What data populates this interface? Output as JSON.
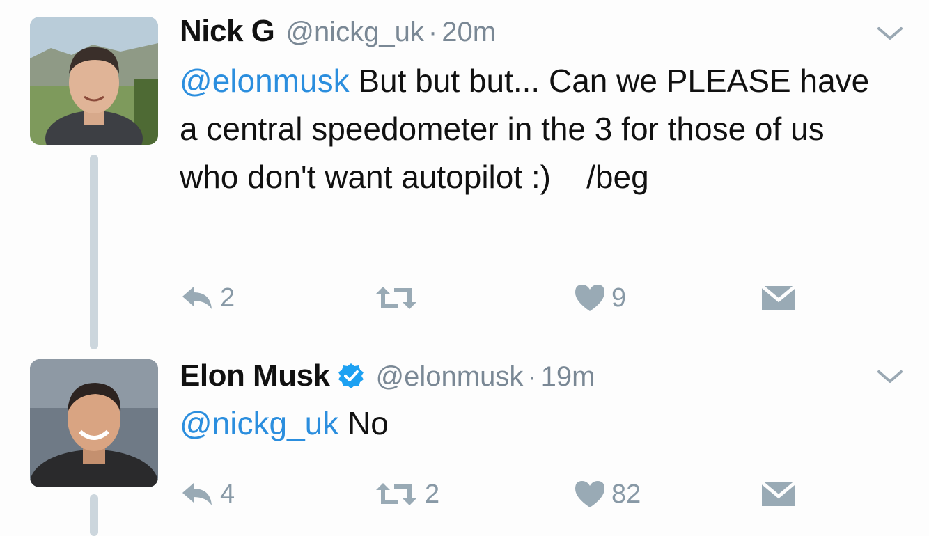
{
  "tweets": [
    {
      "name": "Nick G",
      "handle": "@nickg_uk",
      "separator": "·",
      "time": "20m",
      "verified": false,
      "mention": "@elonmusk",
      "body": "But but but... Can we PLEASE have a central speedometer in the 3 for those of us who don't want autopilot :)    /beg",
      "reply_count": "2",
      "retweet_count": "",
      "like_count": "9"
    },
    {
      "name": "Elon Musk",
      "handle": "@elonmusk",
      "separator": "·",
      "time": "19m",
      "verified": true,
      "mention": "@nickg_uk",
      "body": "No",
      "reply_count": "4",
      "retweet_count": "2",
      "like_count": "82"
    }
  ],
  "icons": {
    "reply": "reply-icon",
    "retweet": "retweet-icon",
    "like": "heart-icon",
    "message": "direct-message-icon",
    "more": "chevron-down-icon",
    "verified": "verified-badge-icon"
  },
  "colors": {
    "mention": "#2b8ede",
    "muted": "#7a8895",
    "action": "#99aab5",
    "verified": "#1da1f2",
    "thread_line": "#ccd6dd"
  }
}
